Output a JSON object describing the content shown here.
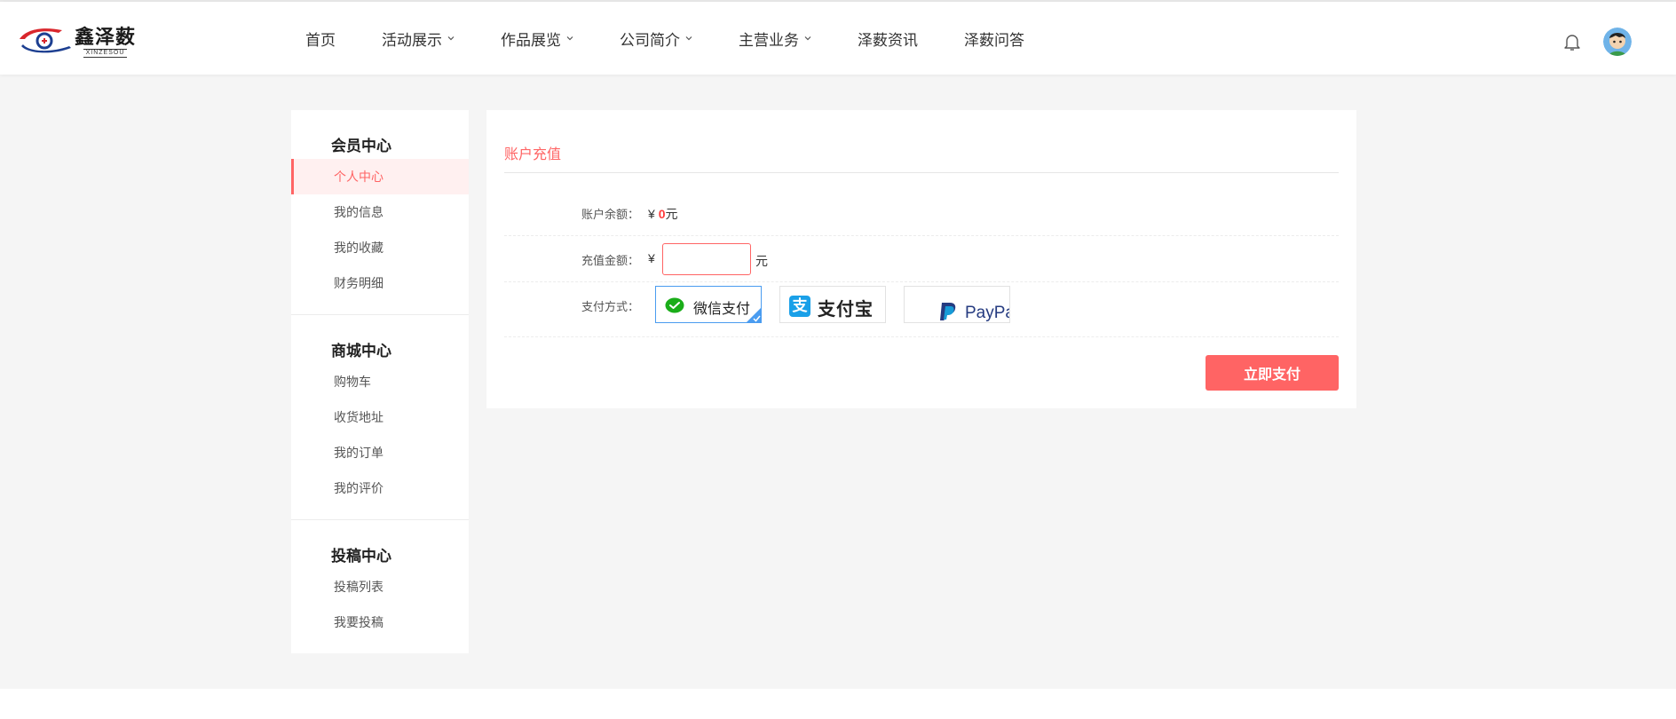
{
  "brand": {
    "name_cn": "鑫泽薮",
    "name_en": "XINZESOU"
  },
  "nav": {
    "items": [
      {
        "label": "首页",
        "dropdown": false
      },
      {
        "label": "活动展示",
        "dropdown": true
      },
      {
        "label": "作品展览",
        "dropdown": true
      },
      {
        "label": "公司简介",
        "dropdown": true
      },
      {
        "label": "主营业务",
        "dropdown": true
      },
      {
        "label": "泽薮资讯",
        "dropdown": false
      },
      {
        "label": "泽薮问答",
        "dropdown": false
      }
    ]
  },
  "header_icons": {
    "notification": "bell-icon",
    "user": "avatar"
  },
  "sidebar": {
    "groups": [
      {
        "title": "会员中心",
        "items": [
          {
            "label": "个人中心",
            "active": true
          },
          {
            "label": "我的信息",
            "active": false
          },
          {
            "label": "我的收藏",
            "active": false
          },
          {
            "label": "财务明细",
            "active": false
          }
        ]
      },
      {
        "title": "商城中心",
        "items": [
          {
            "label": "购物车",
            "active": false
          },
          {
            "label": "收货地址",
            "active": false
          },
          {
            "label": "我的订单",
            "active": false
          },
          {
            "label": "我的评价",
            "active": false
          }
        ]
      },
      {
        "title": "投稿中心",
        "items": [
          {
            "label": "投稿列表",
            "active": false
          },
          {
            "label": "我要投稿",
            "active": false
          }
        ]
      }
    ]
  },
  "recharge": {
    "title": "账户充值",
    "balance_label": "账户余额：",
    "currency_symbol": "¥",
    "balance_value": "0",
    "unit": "元",
    "amount_label": "充值金额：",
    "amount_value": "",
    "method_label": "支付方式：",
    "methods": [
      {
        "label": "微信支付",
        "icon": "wechat-pay-icon",
        "selected": true
      },
      {
        "label": "支付宝",
        "icon": "alipay-icon",
        "selected": false
      },
      {
        "label": "PayPal",
        "icon": "paypal-icon",
        "selected": false
      }
    ],
    "submit_label": "立即支付"
  },
  "colors": {
    "accent": "#ff6464",
    "active_bg": "#fff0f0",
    "page_bg": "#f5f5f5",
    "selected_border": "#4a9cf0",
    "wechat_green": "#1aad19",
    "alipay_blue": "#1aa0e8",
    "paypal_navy": "#253b80"
  }
}
